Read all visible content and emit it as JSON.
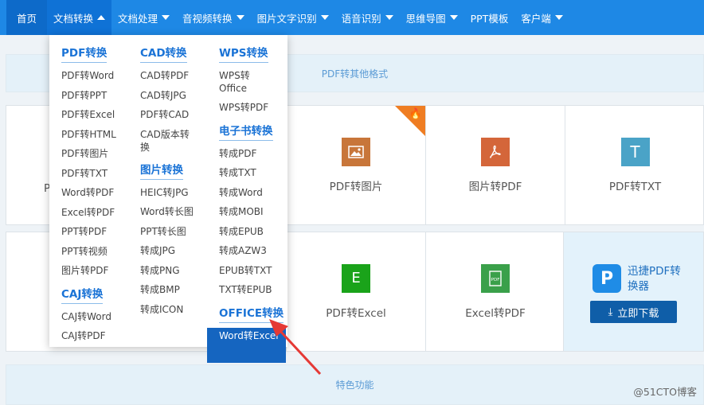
{
  "nav": {
    "items": [
      {
        "label": "首页",
        "caret": false
      },
      {
        "label": "文档转换",
        "caret": true
      },
      {
        "label": "文档处理",
        "caret": true
      },
      {
        "label": "音视频转换",
        "caret": true
      },
      {
        "label": "图片文字识别",
        "caret": true
      },
      {
        "label": "语音识别",
        "caret": true
      },
      {
        "label": "思维导图",
        "caret": true
      },
      {
        "label": "PPT模板",
        "caret": false
      },
      {
        "label": "客户端",
        "caret": true
      }
    ]
  },
  "banner_top": "PDF转其他格式",
  "banner_bottom": "特色功能",
  "row1": {
    "partial_letter": "P",
    "tiles": [
      {
        "label": "PDF转图片",
        "icon": "image-icon",
        "color": "#c8763a"
      },
      {
        "label": "图片转PDF",
        "icon": "pdf-icon",
        "color": "#d4663a"
      },
      {
        "label": "PDF转TXT",
        "icon": "T",
        "color": "#4aa3c7"
      }
    ]
  },
  "row2": {
    "tiles": [
      {
        "label": "PDF转Excel",
        "icon": "E",
        "color": "#1aa31a"
      },
      {
        "label": "Excel转PDF",
        "icon": "PDF",
        "color": "#3aa04a"
      }
    ]
  },
  "promo": {
    "logo_letter": "P",
    "title": "迅捷PDF转换器",
    "download": "立即下载"
  },
  "dropdown": {
    "col1": [
      {
        "type": "head",
        "label": "PDF转换"
      },
      {
        "type": "item",
        "label": "PDF转Word"
      },
      {
        "type": "item",
        "label": "PDF转PPT"
      },
      {
        "type": "item",
        "label": "PDF转Excel"
      },
      {
        "type": "item",
        "label": "PDF转HTML"
      },
      {
        "type": "item",
        "label": "PDF转图片"
      },
      {
        "type": "item",
        "label": "PDF转TXT"
      },
      {
        "type": "item",
        "label": "Word转PDF"
      },
      {
        "type": "item",
        "label": "Excel转PDF"
      },
      {
        "type": "item",
        "label": "PPT转PDF"
      },
      {
        "type": "item",
        "label": "PPT转视频"
      },
      {
        "type": "item",
        "label": "图片转PDF"
      },
      {
        "type": "head",
        "label": "CAJ转换"
      },
      {
        "type": "item",
        "label": "CAJ转Word"
      },
      {
        "type": "item",
        "label": "CAJ转PDF"
      }
    ],
    "col2": [
      {
        "type": "head",
        "label": "CAD转换"
      },
      {
        "type": "item",
        "label": "CAD转PDF"
      },
      {
        "type": "item",
        "label": "CAD转JPG"
      },
      {
        "type": "item",
        "label": "PDF转CAD"
      },
      {
        "type": "item2",
        "label": "CAD版本转换"
      },
      {
        "type": "head",
        "label": "图片转换"
      },
      {
        "type": "item",
        "label": "HEIC转JPG"
      },
      {
        "type": "item",
        "label": "Word转长图"
      },
      {
        "type": "item",
        "label": "PPT转长图"
      },
      {
        "type": "item",
        "label": "转成JPG"
      },
      {
        "type": "item",
        "label": "转成PNG"
      },
      {
        "type": "item",
        "label": "转成BMP"
      },
      {
        "type": "item",
        "label": "转成ICON"
      }
    ],
    "col3": [
      {
        "type": "head",
        "label": "WPS转换"
      },
      {
        "type": "item2",
        "label": "WPS转Office"
      },
      {
        "type": "item",
        "label": "WPS转PDF"
      },
      {
        "type": "head",
        "label": "电子书转换"
      },
      {
        "type": "item",
        "label": "转成PDF"
      },
      {
        "type": "item",
        "label": "转成TXT"
      },
      {
        "type": "item",
        "label": "转成Word"
      },
      {
        "type": "item",
        "label": "转成MOBI"
      },
      {
        "type": "item",
        "label": "转成EPUB"
      },
      {
        "type": "item",
        "label": "转成AZW3"
      },
      {
        "type": "item",
        "label": "EPUB转TXT"
      },
      {
        "type": "item",
        "label": "TXT转EPUB"
      },
      {
        "type": "head",
        "label": "OFFICE转换"
      },
      {
        "type": "highlight",
        "label": "Word转Excel"
      }
    ]
  },
  "watermark": "@51CTO博客",
  "colors": {
    "nav": "#1e88e5",
    "accent": "#1a73d6",
    "highlight": "#1565c0",
    "arrow": "#e53935"
  }
}
